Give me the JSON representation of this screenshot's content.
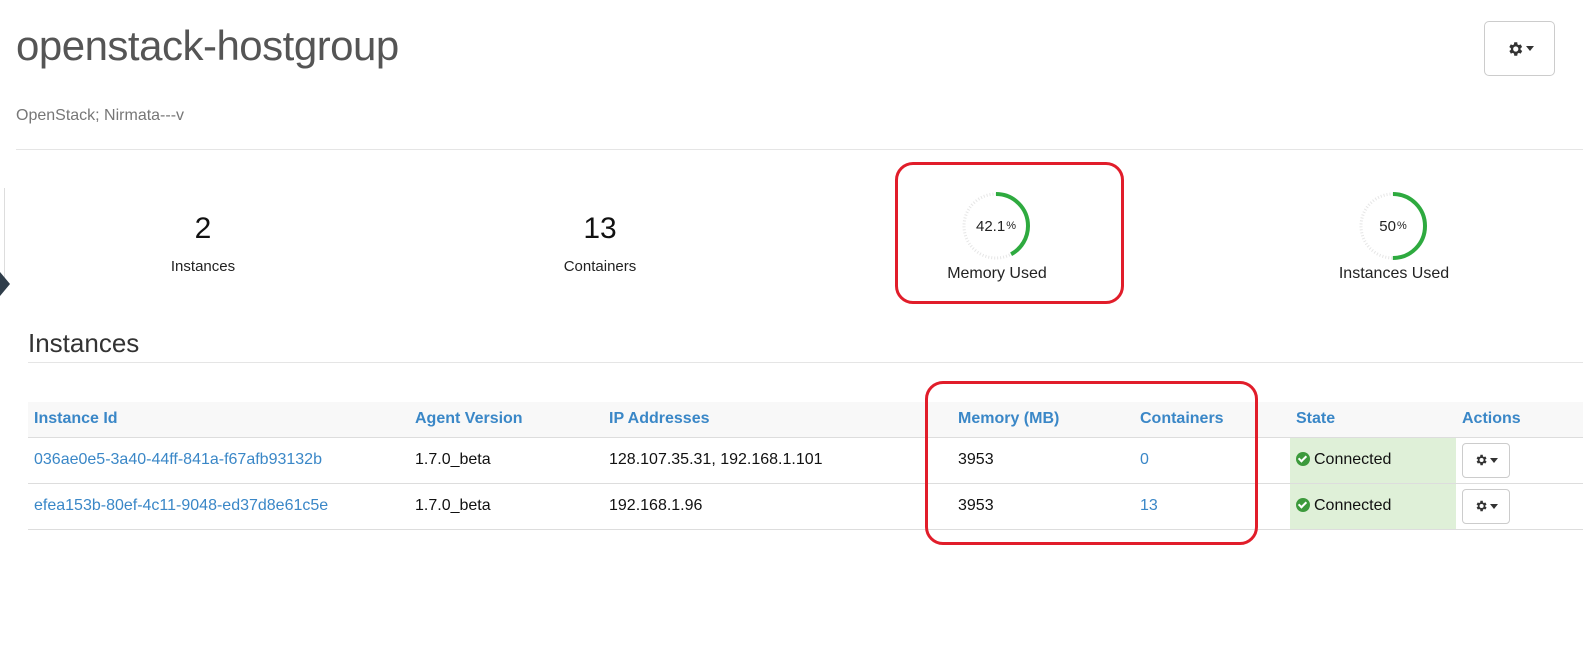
{
  "header": {
    "title": "openstack-hostgroup",
    "subtitle": "OpenStack; Nirmata---v"
  },
  "stats": {
    "instances": {
      "value": "2",
      "label": "Instances"
    },
    "containers": {
      "value": "13",
      "label": "Containers"
    },
    "memory_used": {
      "value": "42.1",
      "unit": "%",
      "label": "Memory Used",
      "fraction": 0.421
    },
    "instances_used": {
      "value": "50",
      "unit": "%",
      "label": "Instances Used",
      "fraction": 0.5
    }
  },
  "instances_section": {
    "title": "Instances",
    "columns": [
      "Instance Id",
      "Agent Version",
      "IP Addresses",
      "Memory (MB)",
      "Containers",
      "State",
      "Actions"
    ],
    "rows": [
      {
        "id": "036ae0e5-3a40-44ff-841a-f67afb93132b",
        "agent_version": "1.7.0_beta",
        "ip_addresses": "128.107.35.31, 192.168.1.101",
        "memory": "3953",
        "containers": "0",
        "state": "Connected"
      },
      {
        "id": "efea153b-80ef-4c11-9048-ed37d8e61c5e",
        "agent_version": "1.7.0_beta",
        "ip_addresses": "192.168.1.96",
        "memory": "3953",
        "containers": "13",
        "state": "Connected"
      }
    ]
  },
  "icons": {
    "settings": "gear-icon",
    "dropdown": "caret-down-icon",
    "status": "check-circle-icon"
  },
  "colors": {
    "accent": "#3a87c7",
    "gauge": "#2eaa3f",
    "highlight": "#e11d2a",
    "state_bg": "#dff0d8"
  }
}
